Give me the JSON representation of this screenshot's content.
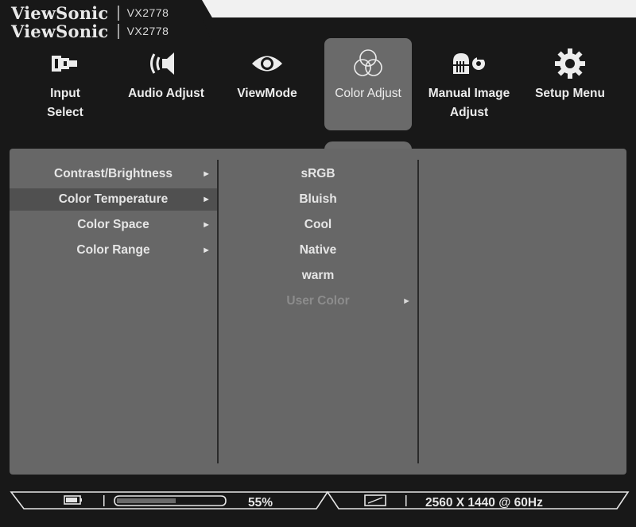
{
  "brand": {
    "name": "ViewSonic",
    "separator": "|",
    "model": "VX2778"
  },
  "nav": [
    {
      "label_line1": "Input",
      "label_line2": "Select",
      "icon": "input-select-icon"
    },
    {
      "label_line1": "Audio Adjust",
      "label_line2": "",
      "icon": "speaker-icon"
    },
    {
      "label_line1": "ViewMode",
      "label_line2": "",
      "icon": "eye-icon"
    },
    {
      "label_line1": "Color Adjust",
      "label_line2": "",
      "icon": "color-circles-icon",
      "active": true
    },
    {
      "label_line1": "Manual Image",
      "label_line2": "Adjust",
      "icon": "image-adjust-icon"
    },
    {
      "label_line1": "Setup Menu",
      "label_line2": "",
      "icon": "gear-icon"
    }
  ],
  "menu": {
    "items": [
      {
        "label": "Contrast/Brightness",
        "arrow": "►"
      },
      {
        "label": "Color Temperature",
        "arrow": "►",
        "selected": true
      },
      {
        "label": "Color Space",
        "arrow": "►"
      },
      {
        "label": "Color Range",
        "arrow": "►"
      }
    ]
  },
  "submenu": {
    "items": [
      {
        "label": "sRGB"
      },
      {
        "label": "Bluish"
      },
      {
        "label": "Cool"
      },
      {
        "label": "Native"
      },
      {
        "label": "warm"
      },
      {
        "label": "User Color",
        "arrow": "►",
        "disabled": true
      }
    ]
  },
  "status": {
    "brightness_percent": 55,
    "brightness_text": "55%",
    "resolution": "2560 X 1440 @ 60Hz"
  },
  "colors": {
    "osd_bg": "#181818",
    "panel_bg": "#676767",
    "active_tab": "#6a6a6a",
    "selected_row": "#505050",
    "text": "#e6e6e6",
    "disabled_text": "#8c8c8c"
  }
}
